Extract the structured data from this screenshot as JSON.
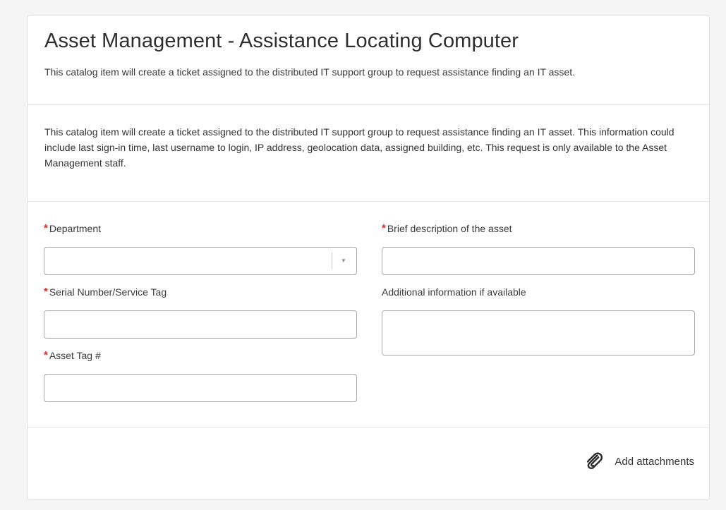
{
  "catalog_item": {
    "title": "Asset Management - Assistance Locating Computer",
    "short_description": "This catalog item will create a ticket assigned to the distributed IT support group to request assistance finding an IT asset.",
    "description": "This catalog item will create a ticket assigned to the distributed IT support group to request assistance finding an IT asset. This information could include last sign-in time, last username to login, IP address, geolocation data, assigned building, etc. This request is only available to the Asset Management staff."
  },
  "form": {
    "required_marker": "*",
    "department": {
      "label": "Department",
      "value": "",
      "required": true
    },
    "serial_number": {
      "label": "Serial Number/Service Tag",
      "value": "",
      "required": true
    },
    "asset_tag": {
      "label": "Asset Tag #",
      "value": "",
      "required": true
    },
    "brief_description": {
      "label": "Brief description of the asset",
      "value": "",
      "required": true
    },
    "additional_info": {
      "label": "Additional information if available",
      "value": "",
      "required": false
    }
  },
  "footer": {
    "attachments_label": "Add attachments",
    "attachments_icon": "paperclip-icon"
  },
  "colors": {
    "required_marker": "#c9302c",
    "border": "#a8a8a8",
    "background": "#f5f5f5",
    "card": "#ffffff"
  }
}
